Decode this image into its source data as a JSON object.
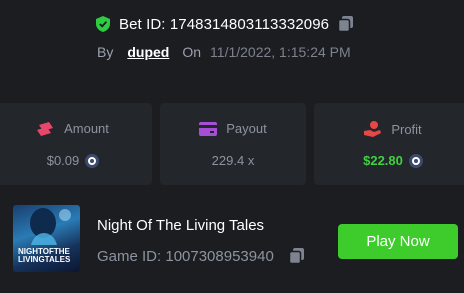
{
  "bet": {
    "id_text": "Bet ID: 1748314803113332096",
    "by_label": "By",
    "user": "duped",
    "on_label": "On",
    "datetime": "11/1/2022, 1:15:24 PM"
  },
  "stats": [
    {
      "label": "Amount",
      "value": "$0.09",
      "icon": "money-fly-icon"
    },
    {
      "label": "Payout",
      "value": "229.4 x",
      "icon": "card-icon"
    },
    {
      "label": "Profit",
      "value": "$22.80",
      "icon": "hand-coin-icon"
    }
  ],
  "game": {
    "thumb_lines": [
      "NIGHTOFTHE",
      "LIVINGTALES"
    ],
    "title": "Night Of The Living Tales",
    "id_text": "Game ID: 1007308953940",
    "play_label": "Play Now"
  },
  "colors": {
    "accent_green": "#3dcc2b",
    "profit_green": "#3fd13f",
    "verified_green": "#2ecc40"
  }
}
